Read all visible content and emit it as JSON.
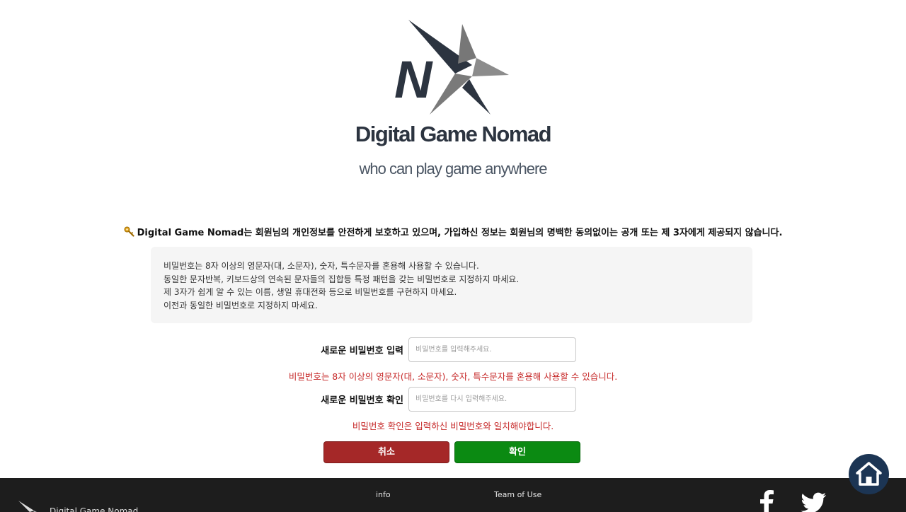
{
  "brand": {
    "logo_letter": "N",
    "title": "Digital Game Nomad",
    "tagline": "who can play game anywhere"
  },
  "notice": {
    "icon": "key-icon",
    "text": "Digital Game Nomad는 회원님의 개인정보를 안전하게 보호하고 있으며, 가입하신 정보는 회원님의 명백한 동의없이는 공개 또는 제 3자에게 제공되지 않습니다."
  },
  "rules": [
    "비밀번호는 8자 이상의 영문자(대, 소문자), 숫자, 특수문자를 혼용해 사용할 수 있습니다.",
    "동일한 문자반복, 키보드상의 연속된 문자들의 집합등 특정 패턴을 갖는 비밀번호로 지정하지 마세요.",
    "제 3자가 쉽게 알 수 있는 이름, 생일 휴대전화 등으로 비밀번호를 구현하지 마세요.",
    "이전과 동일한 비밀번호로 지정하지 마세요."
  ],
  "form": {
    "new_password": {
      "label": "새로운 비밀번호 입력",
      "placeholder": "비밀번호를 입력해주세요.",
      "value": "",
      "error": "비밀번호는 8자 이상의 영문자(대, 소문자), 숫자, 특수문자를 혼용해 사용할 수 있습니다."
    },
    "confirm_password": {
      "label": "새로운 비밀번호 확인",
      "placeholder": "비밀번호를 다시 입력해주세요.",
      "value": "",
      "error": "비밀번호 확인은 입력하신 비밀번호와 일치해야합니다."
    },
    "cancel_label": "취소",
    "confirm_label": "확인"
  },
  "footer": {
    "brand": "Digital Game Nomad",
    "links": [
      "info",
      "Team of Use"
    ],
    "social": [
      "facebook-icon",
      "twitter-icon"
    ]
  },
  "fab": {
    "icon": "home-icon"
  },
  "colors": {
    "brand_dark": "#2c3440",
    "brand_gray": "#8a8a8a",
    "error": "#c62828",
    "cancel": "#a52828",
    "confirm": "#0b8a12",
    "footer_bg": "#1d1d1d",
    "fab_bg": "#1c3554"
  }
}
